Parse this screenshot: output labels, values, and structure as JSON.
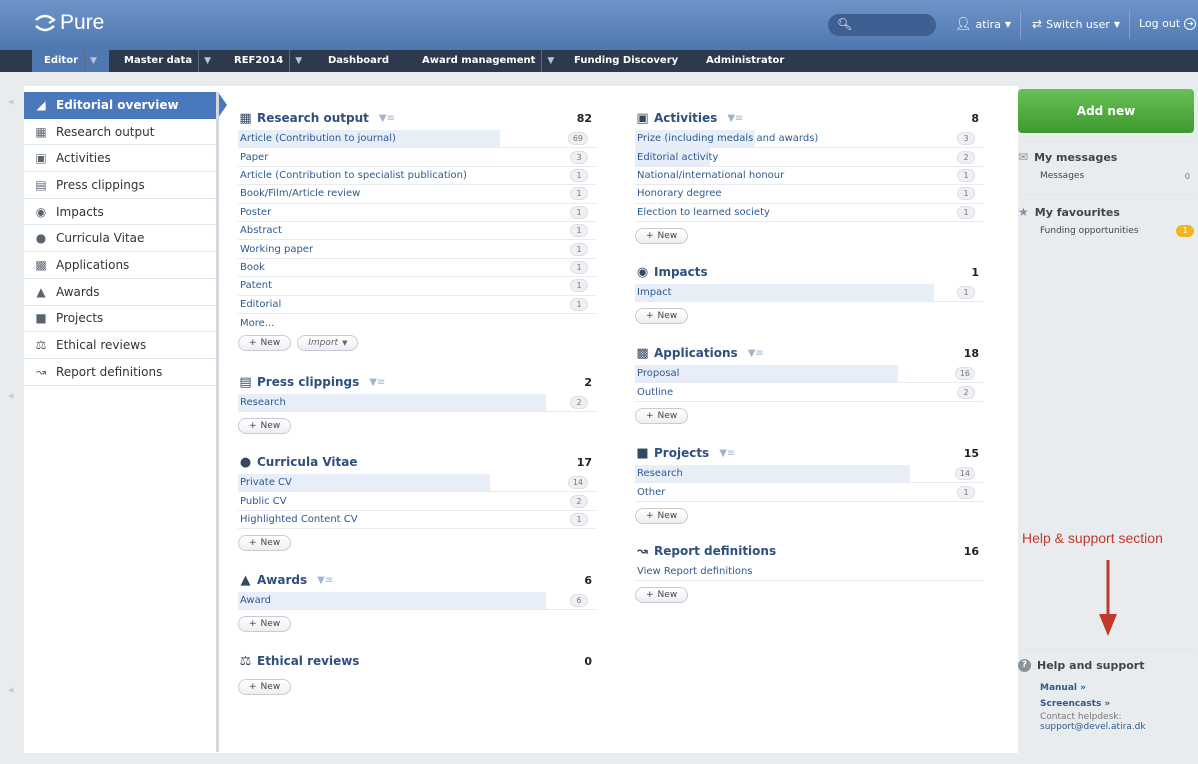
{
  "app": {
    "logo": "Pure"
  },
  "topbar": {
    "user": "atira",
    "switch_user": "Switch user",
    "logout": "Log out"
  },
  "nav": [
    {
      "label": "Editor",
      "dropdown": true
    },
    {
      "label": "Master data",
      "dropdown": true
    },
    {
      "label": "REF2014",
      "dropdown": true
    },
    {
      "label": "Dashboard",
      "dropdown": false
    },
    {
      "label": "Award management",
      "dropdown": true
    },
    {
      "label": "Funding Discovery",
      "dropdown": false
    },
    {
      "label": "Administrator",
      "dropdown": false
    }
  ],
  "sidebar": {
    "items": [
      {
        "label": "Editorial overview",
        "icon": "editorial-icon"
      },
      {
        "label": "Research output",
        "icon": "book-icon"
      },
      {
        "label": "Activities",
        "icon": "briefcase-icon"
      },
      {
        "label": "Press clippings",
        "icon": "newspaper-icon"
      },
      {
        "label": "Impacts",
        "icon": "target-icon"
      },
      {
        "label": "Curricula Vitae",
        "icon": "cv-icon"
      },
      {
        "label": "Applications",
        "icon": "applications-icon"
      },
      {
        "label": "Awards",
        "icon": "moneybag-icon"
      },
      {
        "label": "Projects",
        "icon": "cube-icon"
      },
      {
        "label": "Ethical reviews",
        "icon": "scales-icon"
      },
      {
        "label": "Report definitions",
        "icon": "chart-icon"
      }
    ]
  },
  "buttons": {
    "new": "New",
    "import": "Import"
  },
  "sections": {
    "research_output": {
      "title": "Research output",
      "total": "82",
      "rows": [
        {
          "label": "Article (Contribution to journal)",
          "count": "69",
          "fill": 0.85
        },
        {
          "label": "Paper",
          "count": "3",
          "fill": 0
        },
        {
          "label": "Article (Contribution to specialist publication)",
          "count": "1",
          "fill": 0
        },
        {
          "label": "Book/Film/Article review",
          "count": "1",
          "fill": 0
        },
        {
          "label": "Poster",
          "count": "1",
          "fill": 0
        },
        {
          "label": "Abstract",
          "count": "1",
          "fill": 0
        },
        {
          "label": "Working paper",
          "count": "1",
          "fill": 0
        },
        {
          "label": "Book",
          "count": "1",
          "fill": 0
        },
        {
          "label": "Patent",
          "count": "1",
          "fill": 0
        },
        {
          "label": "Editorial",
          "count": "1",
          "fill": 0
        }
      ],
      "more": "More..."
    },
    "press_clippings": {
      "title": "Press clippings",
      "total": "2",
      "rows": [
        {
          "label": "Research",
          "count": "2",
          "fill": 1
        }
      ]
    },
    "curricula_vitae": {
      "title": "Curricula Vitae",
      "total": "17",
      "rows": [
        {
          "label": "Private CV",
          "count": "14",
          "fill": 0.82
        },
        {
          "label": "Public CV",
          "count": "2",
          "fill": 0
        },
        {
          "label": "Highlighted Content CV",
          "count": "1",
          "fill": 0
        }
      ]
    },
    "awards": {
      "title": "Awards",
      "total": "6",
      "rows": [
        {
          "label": "Award",
          "count": "6",
          "fill": 1
        }
      ]
    },
    "ethical_reviews": {
      "title": "Ethical reviews",
      "total": "0",
      "rows": []
    },
    "activities": {
      "title": "Activities",
      "total": "8",
      "rows": [
        {
          "label": "Prize (including medals and awards)",
          "count": "3",
          "fill": 0.4
        },
        {
          "label": "Editorial activity",
          "count": "2",
          "fill": 0.25
        },
        {
          "label": "National/international honour",
          "count": "1",
          "fill": 0
        },
        {
          "label": "Honorary degree",
          "count": "1",
          "fill": 0
        },
        {
          "label": "Election to learned society",
          "count": "1",
          "fill": 0
        }
      ]
    },
    "impacts": {
      "title": "Impacts",
      "total": "1",
      "rows": [
        {
          "label": "Impact",
          "count": "1",
          "fill": 1
        }
      ]
    },
    "applications": {
      "title": "Applications",
      "total": "18",
      "rows": [
        {
          "label": "Proposal",
          "count": "16",
          "fill": 0.88
        },
        {
          "label": "Outline",
          "count": "2",
          "fill": 0
        }
      ]
    },
    "projects": {
      "title": "Projects",
      "total": "15",
      "rows": [
        {
          "label": "Research",
          "count": "14",
          "fill": 0.92
        },
        {
          "label": "Other",
          "count": "1",
          "fill": 0
        }
      ]
    },
    "report_definitions": {
      "title": "Report definitions",
      "total": "16",
      "rows": [
        {
          "label": "View Report definitions",
          "count": "",
          "fill": 0
        }
      ]
    }
  },
  "right": {
    "add_new": "Add new",
    "messages": {
      "title": "My messages",
      "row_label": "Messages",
      "count": "0"
    },
    "favourites": {
      "title": "My favourites",
      "row_label": "Funding opportunities",
      "count": "1"
    },
    "annotation": "Help & support section",
    "help": {
      "title": "Help and support",
      "manual": "Manual »",
      "screencasts": "Screencasts »",
      "contact": "Contact helpdesk:",
      "email": "support@devel.atira.dk"
    }
  }
}
